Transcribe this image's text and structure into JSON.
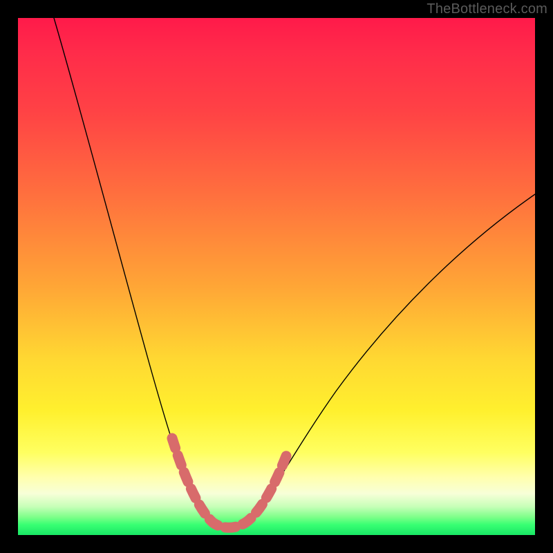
{
  "watermark": "TheBottleneck.com",
  "chart_data": {
    "type": "line",
    "title": "",
    "xlabel": "",
    "ylabel": "",
    "xlim": [
      0,
      100
    ],
    "ylim": [
      0,
      100
    ],
    "grid": false,
    "legend": false,
    "series": [
      {
        "name": "bottleneck-curve",
        "x": [
          7,
          10,
          14,
          18,
          22,
          26,
          29,
          32,
          34,
          36,
          38,
          40,
          42,
          44,
          46,
          48,
          52,
          58,
          66,
          76,
          88,
          100
        ],
        "values": [
          100,
          90,
          78,
          66,
          54,
          42,
          31,
          21,
          14,
          8,
          4,
          2,
          2,
          4,
          8,
          14,
          23,
          33,
          44,
          54,
          62,
          68
        ]
      }
    ],
    "annotations": [
      {
        "name": "valley-highlight",
        "style": "thick-dashed",
        "color": "#d86b6b",
        "x_range": [
          30,
          50
        ]
      }
    ]
  }
}
